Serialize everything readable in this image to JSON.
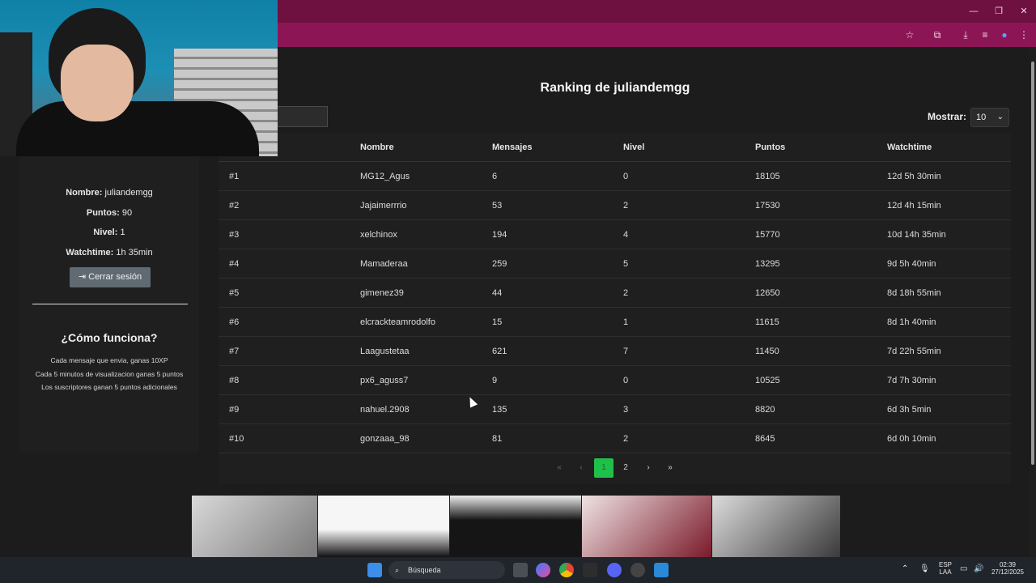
{
  "browser": {
    "minimize_glyph": "—",
    "maximize_glyph": "❐",
    "close_glyph": "✕",
    "toolbar_icons": [
      "star-icon",
      "extensions-icon",
      "download-icon",
      "media-icon",
      "profile-icon",
      "menu-icon"
    ],
    "toolbar_glyphs": [
      "☆",
      "⧉",
      "⤓",
      "≡",
      "●",
      "⋮"
    ],
    "accent": "#8c1655"
  },
  "sidebar": {
    "nombre_label": "Nombre:",
    "nombre_value": "juliandemgg",
    "puntos_label": "Puntos:",
    "puntos_value": "90",
    "nivel_label": "Nivel:",
    "nivel_value": "1",
    "watchtime_label": "Watchtime:",
    "watchtime_value": "1h 35min",
    "logout_label": "Cerrar sesión",
    "how_title": "¿Cómo funciona?",
    "how_lines": [
      "Cada mensaje que envia, ganas 10XP",
      "Cada 5 minutos de visualizacion ganas 5 puntos",
      "Los suscriptores ganan 5 puntos adicionales"
    ]
  },
  "main": {
    "title": "Ranking de juliandemgg",
    "show_label": "Mostrar:",
    "show_value": "10",
    "columns": [
      "Nombre",
      "Mensajes",
      "Nivel",
      "Puntos",
      "Watchtime"
    ],
    "rows": [
      {
        "rank": "#1",
        "name": "MG12_Agus",
        "messages": "6",
        "level": "0",
        "points": "18105",
        "watchtime": "12d 5h 30min"
      },
      {
        "rank": "#2",
        "name": "Jajaimerrrio",
        "messages": "53",
        "level": "2",
        "points": "17530",
        "watchtime": "12d 4h 15min"
      },
      {
        "rank": "#3",
        "name": "xelchinox",
        "messages": "194",
        "level": "4",
        "points": "15770",
        "watchtime": "10d 14h 35min"
      },
      {
        "rank": "#4",
        "name": "Mamaderaa",
        "messages": "259",
        "level": "5",
        "points": "13295",
        "watchtime": "9d 5h 40min"
      },
      {
        "rank": "#5",
        "name": "gimenez39",
        "messages": "44",
        "level": "2",
        "points": "12650",
        "watchtime": "8d 18h 55min"
      },
      {
        "rank": "#6",
        "name": "elcrackteamrodolfo",
        "messages": "15",
        "level": "1",
        "points": "11615",
        "watchtime": "8d 1h 40min"
      },
      {
        "rank": "#7",
        "name": "Laagustetaa",
        "messages": "621",
        "level": "7",
        "points": "11450",
        "watchtime": "7d 22h 55min"
      },
      {
        "rank": "#8",
        "name": "px6_aguss7",
        "messages": "9",
        "level": "0",
        "points": "10525",
        "watchtime": "7d 7h 30min"
      },
      {
        "rank": "#9",
        "name": "nahuel.2908",
        "messages": "135",
        "level": "3",
        "points": "8820",
        "watchtime": "6d 3h 5min"
      },
      {
        "rank": "#10",
        "name": "gonzaaa_98",
        "messages": "81",
        "level": "2",
        "points": "8645",
        "watchtime": "6d 0h 10min"
      }
    ],
    "pagination": {
      "first": "«",
      "prev": "‹",
      "pages": [
        "1",
        "2"
      ],
      "current": "1",
      "next": "›",
      "last": "»",
      "active_color": "#1fbf4b"
    }
  },
  "taskbar": {
    "search_label": "Búsqueda",
    "lang_line1": "ESP",
    "lang_line2": "LAA",
    "time": "02:39",
    "date": "27/12/2025"
  }
}
